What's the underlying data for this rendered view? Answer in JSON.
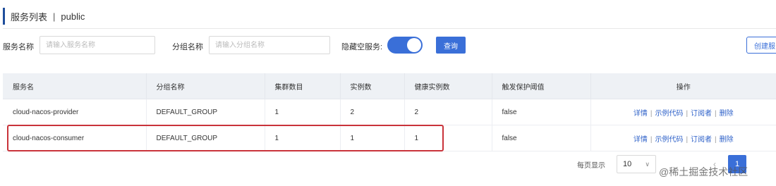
{
  "header": {
    "title": "服务列表",
    "separator": "|",
    "namespace": "public"
  },
  "filters": {
    "service_name_label": "服务名称",
    "service_name_placeholder": "请输入服务名称",
    "group_name_label": "分组名称",
    "group_name_placeholder": "请输入分组名称",
    "hide_empty_label": "隐藏空服务:",
    "hide_empty_enabled": true,
    "query_label": "查询",
    "create_label": "创建服"
  },
  "table": {
    "columns": [
      "服务名",
      "分组名称",
      "集群数目",
      "实例数",
      "健康实例数",
      "触发保护阈值",
      "操作"
    ],
    "rows": [
      {
        "name": "cloud-nacos-provider",
        "group": "DEFAULT_GROUP",
        "clusters": "1",
        "instances": "2",
        "healthy": "2",
        "threshold": "false",
        "ops": [
          "详情",
          "示例代码",
          "订阅者",
          "删除"
        ]
      },
      {
        "name": "cloud-nacos-consumer",
        "group": "DEFAULT_GROUP",
        "clusters": "1",
        "instances": "1",
        "healthy": "1",
        "threshold": "false",
        "ops": [
          "详情",
          "示例代码",
          "订阅者",
          "删除"
        ]
      }
    ]
  },
  "pagination": {
    "page_size_label": "每页显示",
    "page_size": "10",
    "prev": "‹",
    "current_page": "1"
  },
  "watermark": "@稀土掘金技术社区",
  "colors": {
    "primary": "#3a6fd8",
    "highlight_border": "#c9333a",
    "link": "#2f62c9"
  }
}
